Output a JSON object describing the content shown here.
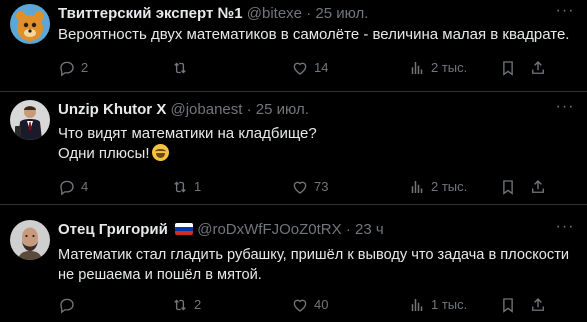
{
  "tweets": [
    {
      "name": "Твиттерский эксперт №1",
      "handle": "@bitexe",
      "dot": "·",
      "time": "25 июл.",
      "text": "Вероятность двух математиков в самолёте - величина малая в квадрате.",
      "replies": "2",
      "retweets": "",
      "likes": "14",
      "views": "2 тыс."
    },
    {
      "name": "Unzip Khutor X",
      "handle": "@jobanest",
      "dot": "·",
      "time": "25 июл.",
      "text": "Что видят математики на кладбище?\nОдни плюсы!",
      "replies": "4",
      "retweets": "1",
      "likes": "73",
      "views": "2 тыс."
    },
    {
      "name": "Отец Григорий",
      "handle": "@roDxWfFJOoZ0tRX",
      "dot": "·",
      "time": "23 ч",
      "text": "Математик стал гладить рубашку, пришёл к выводу что задача в плоскости не решаема и пошёл в мятой.",
      "replies": "",
      "retweets": "2",
      "likes": "40",
      "views": "1 тыс."
    }
  ],
  "icons": {
    "reply": "reply-icon",
    "retweet": "retweet-icon",
    "like": "heart-icon",
    "views": "views-icon",
    "bookmark": "bookmark-icon",
    "share": "share-icon",
    "more": "more-icon"
  },
  "colors": {
    "background": "#000000",
    "text": "#e7e9ea",
    "muted": "#71767b",
    "divider": "#2f3336"
  }
}
